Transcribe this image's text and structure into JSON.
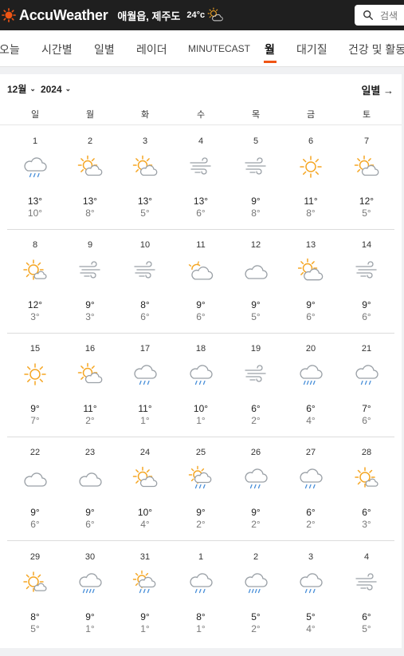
{
  "app": {
    "brand": "AccuWeather",
    "location": "애월읍, 제주도",
    "current_temp": "24°c",
    "current_icon": "partly-sunny-icon",
    "search_placeholder": "검색"
  },
  "nav": {
    "tabs": [
      "오늘",
      "시간별",
      "일별",
      "레이더",
      "MINUTECAST",
      "월",
      "대기질",
      "건강 및 활동"
    ],
    "active": "월"
  },
  "calendar": {
    "month_label": "12월",
    "year_label": "2024",
    "daily_link": "일별",
    "weekdays": [
      "일",
      "월",
      "화",
      "수",
      "목",
      "금",
      "토"
    ],
    "weeks": [
      [
        {
          "day": "1",
          "icon": "cloud-rain-icon",
          "hi": "13°",
          "lo": "10°"
        },
        {
          "day": "2",
          "icon": "partly-sunny-icon",
          "hi": "13°",
          "lo": "8°"
        },
        {
          "day": "3",
          "icon": "partly-sunny-icon",
          "hi": "13°",
          "lo": "5°"
        },
        {
          "day": "4",
          "icon": "wind-icon",
          "hi": "13°",
          "lo": "6°"
        },
        {
          "day": "5",
          "icon": "wind-icon",
          "hi": "9°",
          "lo": "8°"
        },
        {
          "day": "6",
          "icon": "sun-icon",
          "hi": "11°",
          "lo": "8°"
        },
        {
          "day": "7",
          "icon": "partly-sunny-icon",
          "hi": "12°",
          "lo": "5°"
        }
      ],
      [
        {
          "day": "8",
          "icon": "sun-cloud-small-icon",
          "hi": "12°",
          "lo": "3°"
        },
        {
          "day": "9",
          "icon": "wind-icon",
          "hi": "9°",
          "lo": "3°"
        },
        {
          "day": "10",
          "icon": "wind-icon",
          "hi": "8°",
          "lo": "6°"
        },
        {
          "day": "11",
          "icon": "cloud-sun-behind-icon",
          "hi": "9°",
          "lo": "6°"
        },
        {
          "day": "12",
          "icon": "cloud-icon",
          "hi": "9°",
          "lo": "5°"
        },
        {
          "day": "13",
          "icon": "mostly-cloudy-sun-icon",
          "hi": "9°",
          "lo": "6°"
        },
        {
          "day": "14",
          "icon": "wind-icon",
          "hi": "9°",
          "lo": "6°"
        }
      ],
      [
        {
          "day": "15",
          "icon": "sun-icon",
          "hi": "9°",
          "lo": "7°"
        },
        {
          "day": "16",
          "icon": "partly-sunny-icon",
          "hi": "11°",
          "lo": "2°"
        },
        {
          "day": "17",
          "icon": "cloud-rain-icon",
          "hi": "11°",
          "lo": "1°"
        },
        {
          "day": "18",
          "icon": "cloud-rain-icon",
          "hi": "10°",
          "lo": "1°"
        },
        {
          "day": "19",
          "icon": "wind-icon",
          "hi": "6°",
          "lo": "2°"
        },
        {
          "day": "20",
          "icon": "cloud-heavy-rain-icon",
          "hi": "6°",
          "lo": "4°"
        },
        {
          "day": "21",
          "icon": "cloud-rain-icon",
          "hi": "7°",
          "lo": "6°"
        }
      ],
      [
        {
          "day": "22",
          "icon": "cloud-icon",
          "hi": "9°",
          "lo": "6°"
        },
        {
          "day": "23",
          "icon": "cloud-icon",
          "hi": "9°",
          "lo": "6°"
        },
        {
          "day": "24",
          "icon": "partly-sunny-icon",
          "hi": "10°",
          "lo": "4°"
        },
        {
          "day": "25",
          "icon": "sun-rain-icon",
          "hi": "9°",
          "lo": "2°"
        },
        {
          "day": "26",
          "icon": "cloud-rain-icon",
          "hi": "9°",
          "lo": "2°"
        },
        {
          "day": "27",
          "icon": "cloud-rain-icon",
          "hi": "6°",
          "lo": "2°"
        },
        {
          "day": "28",
          "icon": "sun-cloud-small-icon",
          "hi": "6°",
          "lo": "3°"
        }
      ],
      [
        {
          "day": "29",
          "icon": "sun-cloud-small-icon",
          "hi": "8°",
          "lo": "5°"
        },
        {
          "day": "30",
          "icon": "cloud-heavy-rain-icon",
          "hi": "9°",
          "lo": "1°"
        },
        {
          "day": "31",
          "icon": "sun-rain-icon",
          "hi": "9°",
          "lo": "1°"
        },
        {
          "day": "1",
          "icon": "cloud-rain-icon",
          "hi": "8°",
          "lo": "1°"
        },
        {
          "day": "2",
          "icon": "cloud-heavy-rain-icon",
          "hi": "5°",
          "lo": "2°"
        },
        {
          "day": "3",
          "icon": "cloud-rain-icon",
          "hi": "5°",
          "lo": "4°"
        },
        {
          "day": "4",
          "icon": "wind-icon",
          "hi": "6°",
          "lo": "5°"
        }
      ]
    ]
  },
  "colors": {
    "sun": "#f5a623",
    "cloud": "#9aa0a6",
    "rain": "#4a90d9",
    "accent": "#f05514",
    "topbar": "#1f1f1f"
  }
}
